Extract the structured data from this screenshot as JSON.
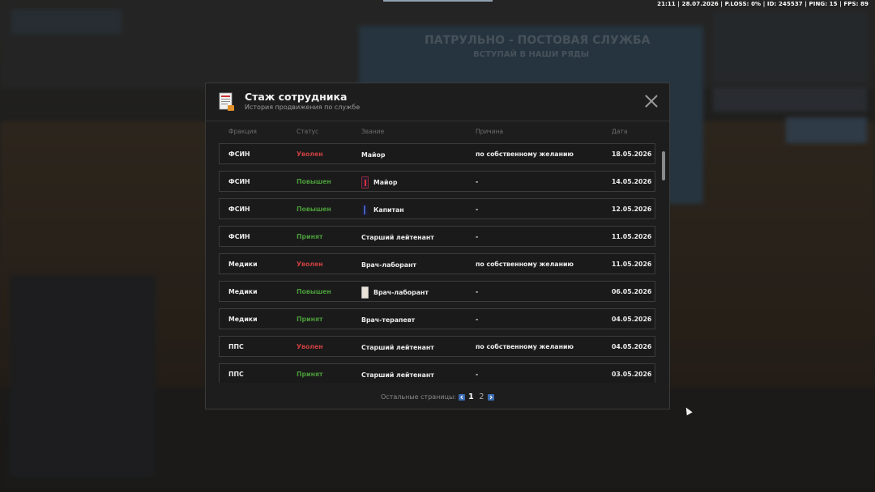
{
  "hud": {
    "text": "21:11 | 28.07.2026 | P.LOSS: 0% | ID: 245537 | PING: 15 | FPS: 89"
  },
  "background": {
    "banner_title": "ПАТРУЛЬНО - ПОСТОВАЯ СЛУЖБА",
    "banner_sub": "ВСТУПАЙ В НАШИ РЯДЫ"
  },
  "modal": {
    "title": "Стаж сотрудника",
    "subtitle": "История продвижения по службе",
    "columns": {
      "faction": "Фракция",
      "status": "Статус",
      "rank": "Звание",
      "reason": "Причина",
      "date": "Дата"
    },
    "rows": [
      {
        "faction": "ФСИН",
        "status": "Уволен",
        "status_type": "fired",
        "rank": "Майор",
        "badge": "none",
        "reason": "по собственному желанию",
        "date": "18.05.2026"
      },
      {
        "faction": "ФСИН",
        "status": "Повышен",
        "status_type": "up",
        "rank": "Майор",
        "badge": "major-icon",
        "reason": "-",
        "date": "14.05.2026"
      },
      {
        "faction": "ФСИН",
        "status": "Повышен",
        "status_type": "up",
        "rank": "Капитан",
        "badge": "captain-icon",
        "reason": "-",
        "date": "12.05.2026"
      },
      {
        "faction": "ФСИН",
        "status": "Принят",
        "status_type": "hired",
        "rank": "Старший лейтенант",
        "badge": "none",
        "reason": "-",
        "date": "11.05.2026"
      },
      {
        "faction": "Медики",
        "status": "Уволен",
        "status_type": "fired",
        "rank": "Врач-лаборант",
        "badge": "none",
        "reason": "по собственному желанию",
        "date": "11.05.2026"
      },
      {
        "faction": "Медики",
        "status": "Повышен",
        "status_type": "up",
        "rank": "Врач-лаборант",
        "badge": "doctor-icon",
        "reason": "-",
        "date": "06.05.2026"
      },
      {
        "faction": "Медики",
        "status": "Принят",
        "status_type": "hired",
        "rank": "Врач-терапевт",
        "badge": "none",
        "reason": "-",
        "date": "04.05.2026"
      },
      {
        "faction": "ППС",
        "status": "Уволен",
        "status_type": "fired",
        "rank": "Старший лейтенант",
        "badge": "none",
        "reason": "по собственному желанию",
        "date": "04.05.2026"
      },
      {
        "faction": "ППС",
        "status": "Принят",
        "status_type": "hired",
        "rank": "Старший лейтенант",
        "badge": "none",
        "reason": "-",
        "date": "03.05.2026"
      }
    ],
    "pager": {
      "label": "Остальные страницы:",
      "current": "1",
      "other": "2"
    }
  },
  "colors": {
    "fired": "#c94040",
    "up": "#4a9a3a",
    "hired": "#4a9a3a",
    "accent": "#3a6ab0"
  }
}
